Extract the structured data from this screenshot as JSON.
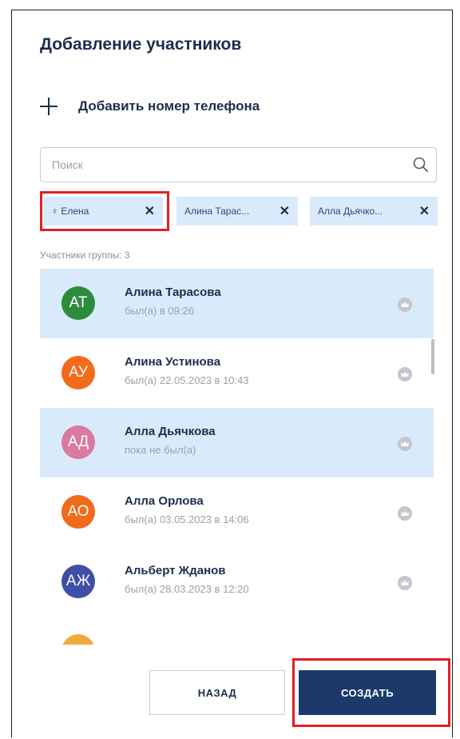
{
  "dialog": {
    "title": "Добавление участников",
    "add_phone_label": "Добавить номер телефона",
    "search_placeholder": "Поиск",
    "members_count_label": "Участники группы: 3"
  },
  "chips": [
    {
      "label": "♀ Елена",
      "remove": "✕"
    },
    {
      "label": "Алина Тарас...",
      "remove": "✕"
    },
    {
      "label": "Алла Дьячко...",
      "remove": "✕"
    }
  ],
  "contacts": [
    {
      "initials": "АТ",
      "name": "Алина Тарасова",
      "status": "был(а) в 09:26",
      "avatar_color": "#2e8b3e",
      "selected": true
    },
    {
      "initials": "АУ",
      "name": "Алина Устинова",
      "status": "был(а) 22.05.2023 в 10:43",
      "avatar_color": "#f26a1b",
      "selected": false
    },
    {
      "initials": "АД",
      "name": "Алла Дьячкова",
      "status": "пока не был(а)",
      "avatar_color": "#d97aa0",
      "selected": true
    },
    {
      "initials": "АО",
      "name": "Алла Орлова",
      "status": "был(а) 03.05.2023 в 14:06",
      "avatar_color": "#f26a1b",
      "selected": false
    },
    {
      "initials": "АЖ",
      "name": "Альберт Жданов",
      "status": "был(а) 28.03.2023 в 12:20",
      "avatar_color": "#3f4fa6",
      "selected": false
    },
    {
      "initials": "",
      "name": "",
      "status": "",
      "avatar_color": "#f2a93b",
      "selected": false
    }
  ],
  "buttons": {
    "back_label": "НАЗАД",
    "create_label": "СОЗДАТЬ"
  },
  "colors": {
    "primary": "#1b3a6b",
    "selected_bg": "#d9ebfa",
    "highlight": "#e31e24",
    "crown": "#c3c7cd"
  },
  "icons": {
    "add": "plus-icon",
    "search": "search-icon",
    "admin_toggle": "crown-icon",
    "chip_remove": "close-icon"
  }
}
